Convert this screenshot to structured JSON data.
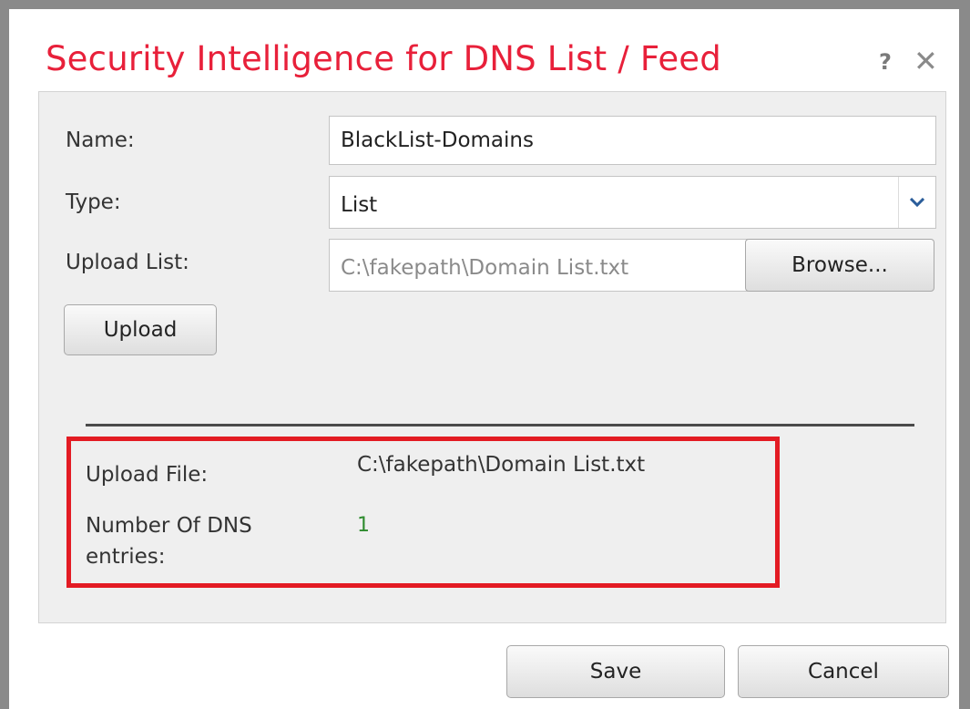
{
  "dialog": {
    "title": "Security Intelligence for DNS List / Feed",
    "help_label": "?",
    "close_label": "✕"
  },
  "form": {
    "name_label": "Name:",
    "name_value": "BlackList-Domains",
    "type_label": "Type:",
    "type_value": "List",
    "upload_list_label": "Upload List:",
    "upload_list_value": "C:\\fakepath\\Domain List.txt",
    "browse_label": "Browse...",
    "upload_button_label": "Upload"
  },
  "upload_result": {
    "file_label": "Upload File:",
    "file_value": "C:\\fakepath\\Domain List.txt",
    "entries_label_line1": "Number Of DNS",
    "entries_label_line2": "entries:",
    "entries_value": "1"
  },
  "footer": {
    "save_label": "Save",
    "cancel_label": "Cancel"
  },
  "colors": {
    "title": "#e8203a",
    "highlight_border": "#e31b23",
    "count_value": "#2e8b2e"
  },
  "icons": {
    "help": "help-icon",
    "close": "close-icon",
    "dropdown": "chevron-down-icon"
  }
}
